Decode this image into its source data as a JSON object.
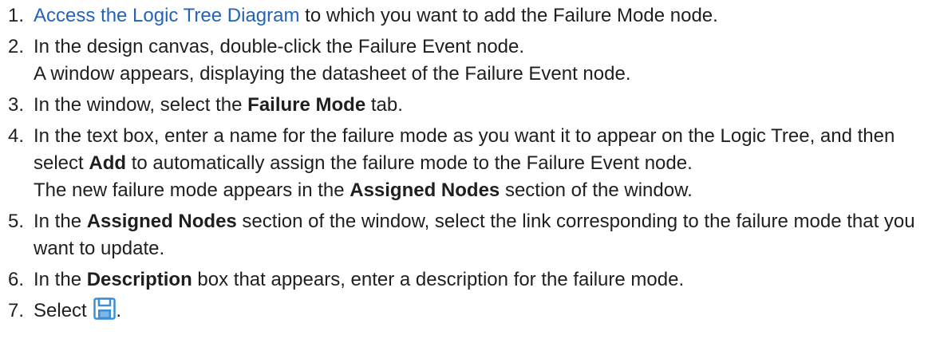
{
  "link_color": "#2563b8",
  "icon_color": "#3b8fd6",
  "steps": [
    {
      "number": "1.",
      "link": "Access the Logic Tree Diagram",
      "text": " to which you want to add the Failure Mode node."
    },
    {
      "number": "2.",
      "text": "In the design canvas, double-click the Failure Event node.",
      "result": "A window appears, displaying the datasheet of the Failure Event node."
    },
    {
      "number": "3.",
      "pre": "In the window, select the ",
      "bold": "Failure Mode",
      "post": " tab."
    },
    {
      "number": "4.",
      "pre": "In the text box, enter a name for the failure mode as you want it to appear on the Logic Tree, and then select ",
      "bold": "Add",
      "post": " to automatically assign the failure mode to the Failure Event node.",
      "result_pre": "The new failure mode appears in the ",
      "result_bold": "Assigned Nodes",
      "result_post": " section of the window."
    },
    {
      "number": "5.",
      "pre": "In the ",
      "bold": "Assigned Nodes",
      "post": " section of the window, select the link corresponding to the failure mode that you want to update."
    },
    {
      "number": "6.",
      "pre": "In the ",
      "bold": "Description",
      "post": " box that appears, enter a description for the failure mode."
    },
    {
      "number": "7.",
      "pre": "Select ",
      "icon": "save-icon",
      "post": "."
    }
  ]
}
